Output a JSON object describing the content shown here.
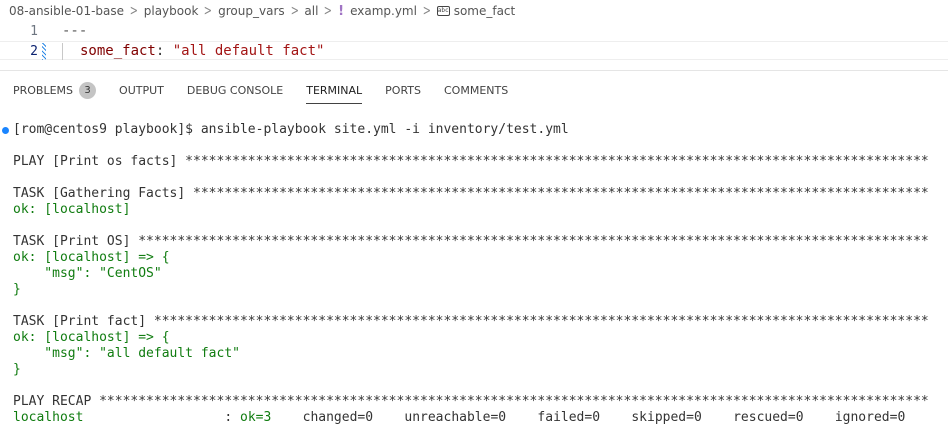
{
  "breadcrumb": {
    "items": [
      "08-ansible-01-base",
      "playbook",
      "group_vars",
      "all",
      "examp.yml",
      "some_fact"
    ],
    "yaml_icon": "!",
    "symbol_icon": "abc"
  },
  "editor": {
    "lines": [
      {
        "number": "1",
        "text": "---"
      },
      {
        "number": "2",
        "key": "some_fact",
        "colon": ": ",
        "value": "\"all default fact\""
      }
    ]
  },
  "panel": {
    "tabs": [
      {
        "label": "PROBLEMS",
        "badge": "3"
      },
      {
        "label": "OUTPUT"
      },
      {
        "label": "DEBUG CONSOLE"
      },
      {
        "label": "TERMINAL",
        "active": true
      },
      {
        "label": "PORTS"
      },
      {
        "label": "COMMENTS"
      }
    ]
  },
  "terminal": {
    "prompt": "[rom@centos9 playbook]$ ansible-playbook site.yml -i inventory/test.yml",
    "play": "PLAY [Print os facts] ***********************************************************************************************",
    "task1": "TASK [Gathering Facts] **********************************************************************************************",
    "task1_ok": "ok: [localhost]",
    "task2": "TASK [Print OS] *****************************************************************************************************",
    "task2_ok": "ok: [localhost] => {",
    "task2_msg": "    \"msg\": \"CentOS\"",
    "task2_close": "}",
    "task3": "TASK [Print fact] ***************************************************************************************************",
    "task3_ok": "ok: [localhost] => {",
    "task3_msg": "    \"msg\": \"all default fact\"",
    "task3_close": "}",
    "recap": "PLAY RECAP **********************************************************************************************************",
    "recap_host": "localhost",
    "recap_sep": "                  : ",
    "recap_ok": "ok=3",
    "recap_rest": "    changed=0    unreachable=0    failed=0    skipped=0    rescued=0    ignored=0"
  }
}
